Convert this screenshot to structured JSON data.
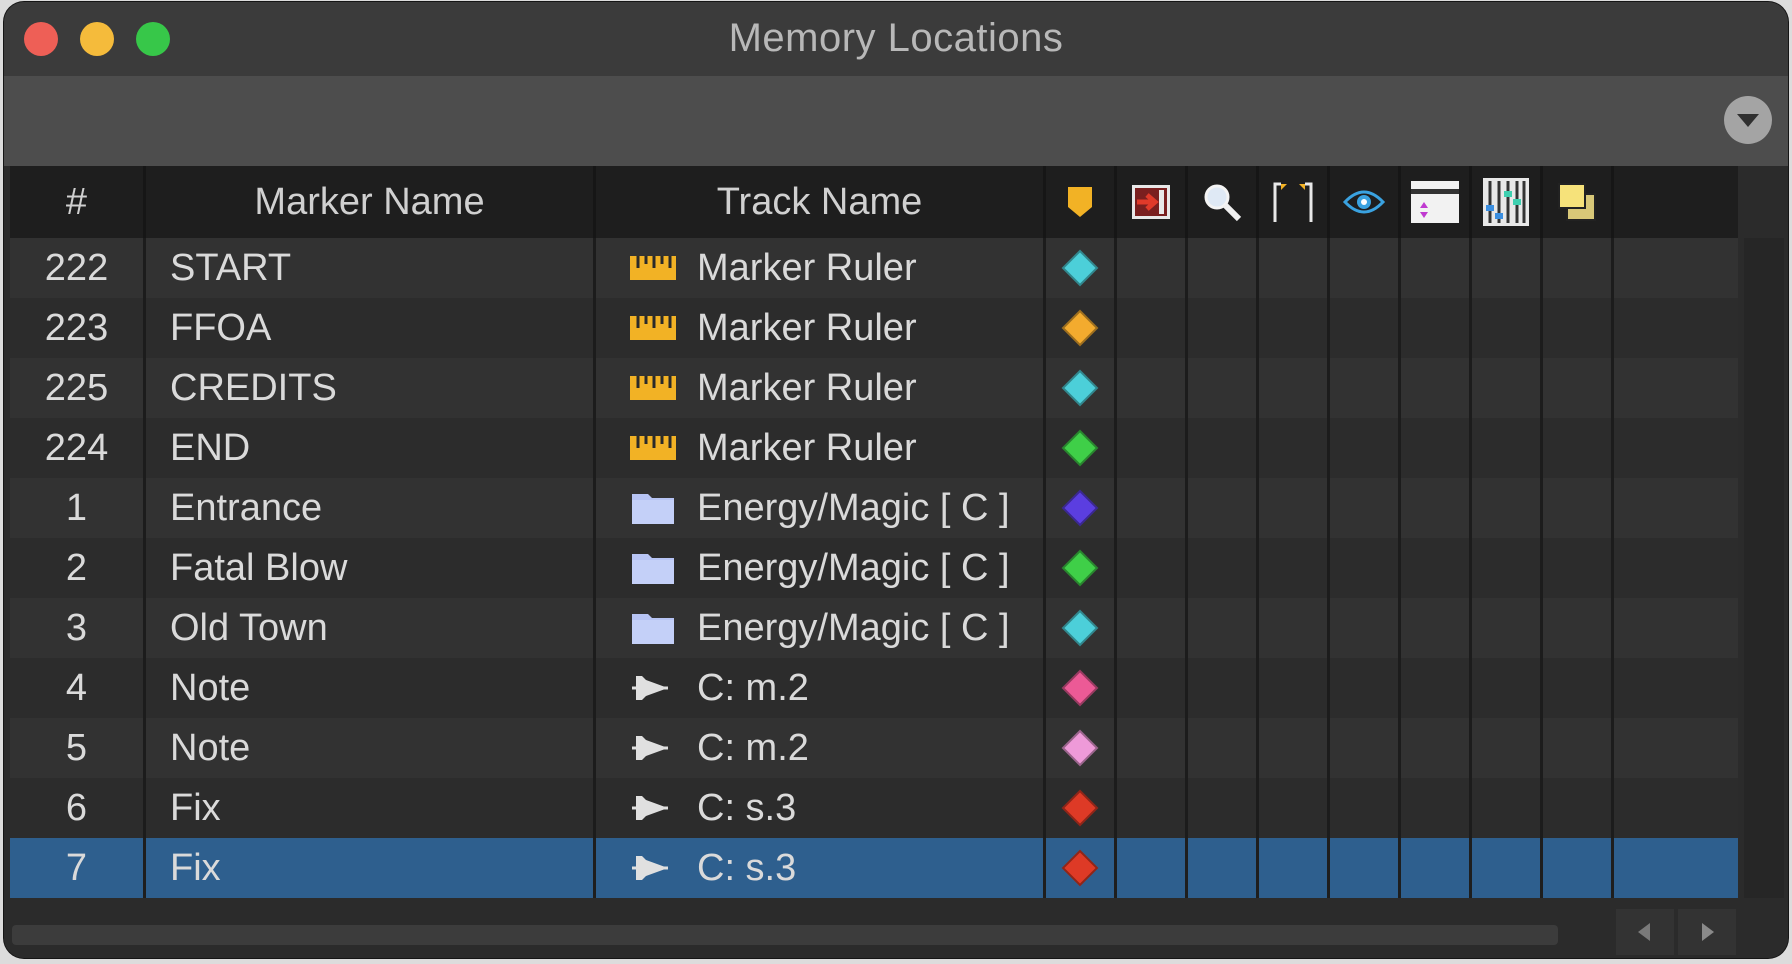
{
  "window": {
    "title": "Memory Locations"
  },
  "columns": {
    "number": "#",
    "marker_name": "Marker Name",
    "track_name": "Track Name",
    "icons": [
      "marker-flag-icon",
      "selection-arrow-icon",
      "zoom-icon",
      "pre-post-roll-icon",
      "track-show-hide-icon",
      "track-height-icon",
      "group-enables-icon",
      "window-config-icon"
    ]
  },
  "rows": [
    {
      "num": "222",
      "name": "START",
      "track_icon": "ruler-icon",
      "track": "Marker Ruler",
      "color": "#4ccfd9",
      "selected": false
    },
    {
      "num": "223",
      "name": "FFOA",
      "track_icon": "ruler-icon",
      "track": "Marker Ruler",
      "color": "#f3ab2e",
      "selected": false
    },
    {
      "num": "225",
      "name": "CREDITS",
      "track_icon": "ruler-icon",
      "track": "Marker Ruler",
      "color": "#4ccfd9",
      "selected": false
    },
    {
      "num": "224",
      "name": "END",
      "track_icon": "ruler-icon",
      "track": "Marker Ruler",
      "color": "#3fcf48",
      "selected": false
    },
    {
      "num": "1",
      "name": "Entrance",
      "track_icon": "folder-icon",
      "track": "Energy/Magic [ C ]",
      "color": "#5b3ee0",
      "selected": false
    },
    {
      "num": "2",
      "name": "Fatal Blow",
      "track_icon": "folder-icon",
      "track": "Energy/Magic [ C ]",
      "color": "#3fcf48",
      "selected": false
    },
    {
      "num": "3",
      "name": "Old Town",
      "track_icon": "folder-icon",
      "track": "Energy/Magic [ C ]",
      "color": "#4ccfd9",
      "selected": false
    },
    {
      "num": "4",
      "name": "Note",
      "track_icon": "clip-arrow-icon",
      "track": "C: m.2",
      "color": "#ec5a96",
      "selected": false
    },
    {
      "num": "5",
      "name": "Note",
      "track_icon": "clip-arrow-icon",
      "track": "C: m.2",
      "color": "#ee9ad8",
      "selected": false
    },
    {
      "num": "6",
      "name": "Fix",
      "track_icon": "clip-arrow-icon",
      "track": "C: s.3",
      "color": "#de3a26",
      "selected": false
    },
    {
      "num": "7",
      "name": "Fix",
      "track_icon": "clip-arrow-icon",
      "track": "C: s.3",
      "color": "#de3a26",
      "selected": true
    }
  ]
}
